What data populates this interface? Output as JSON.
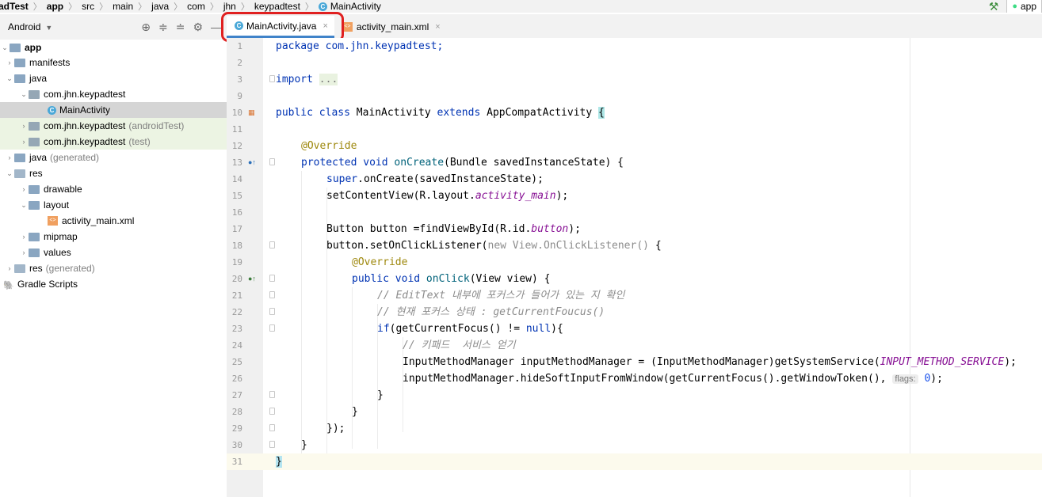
{
  "breadcrumb": {
    "items": [
      "adTest",
      "app",
      "src",
      "main",
      "java",
      "com",
      "jhn",
      "keypadtest",
      "MainActivity"
    ],
    "run_config": "app"
  },
  "project_panel": {
    "view_mode": "Android",
    "tree": [
      {
        "label": "app",
        "suffix": "",
        "indent": 0,
        "type": "module",
        "expanded": true
      },
      {
        "label": "manifests",
        "suffix": "",
        "indent": 1,
        "type": "folder",
        "expanded": false
      },
      {
        "label": "java",
        "suffix": "",
        "indent": 1,
        "type": "folder",
        "expanded": true
      },
      {
        "label": "com.jhn.keypadtest",
        "suffix": "",
        "indent": 2,
        "type": "package",
        "expanded": true
      },
      {
        "label": "MainActivity",
        "suffix": "",
        "indent": 3,
        "type": "class",
        "selected": true
      },
      {
        "label": "com.jhn.keypadtest",
        "suffix": "(androidTest)",
        "indent": 2,
        "type": "package",
        "expanded": false,
        "test": true
      },
      {
        "label": "com.jhn.keypadtest",
        "suffix": "(test)",
        "indent": 2,
        "type": "package",
        "expanded": false,
        "test": true
      },
      {
        "label": "java",
        "suffix": "(generated)",
        "indent": 1,
        "type": "folder",
        "expanded": false
      },
      {
        "label": "res",
        "suffix": "",
        "indent": 1,
        "type": "folder",
        "expanded": true
      },
      {
        "label": "drawable",
        "suffix": "",
        "indent": 2,
        "type": "folder",
        "expanded": false
      },
      {
        "label": "layout",
        "suffix": "",
        "indent": 2,
        "type": "folder",
        "expanded": true
      },
      {
        "label": "activity_main.xml",
        "suffix": "",
        "indent": 3,
        "type": "xml"
      },
      {
        "label": "mipmap",
        "suffix": "",
        "indent": 2,
        "type": "folder",
        "expanded": false
      },
      {
        "label": "values",
        "suffix": "",
        "indent": 2,
        "type": "folder",
        "expanded": false
      },
      {
        "label": "res",
        "suffix": "(generated)",
        "indent": 1,
        "type": "folder",
        "expanded": false
      },
      {
        "label": "Gradle Scripts",
        "suffix": "",
        "indent": 0,
        "type": "gradle",
        "expanded": false
      }
    ]
  },
  "tabs": [
    {
      "label": "MainActivity.java",
      "active": true
    },
    {
      "label": "activity_main.xml",
      "active": false
    }
  ],
  "code": {
    "line_numbers": [
      "1",
      "2",
      "3",
      "9",
      "10",
      "11",
      "12",
      "13",
      "14",
      "15",
      "16",
      "17",
      "18",
      "19",
      "20",
      "21",
      "22",
      "23",
      "24",
      "25",
      "26",
      "27",
      "28",
      "29",
      "30",
      "31"
    ],
    "lines": {
      "l1": "package com.jhn.keypadtest;",
      "l3_kw": "import",
      "l3_fold": "...",
      "l10_a": "public class",
      "l10_b": " MainActivity ",
      "l10_c": "extends",
      "l10_d": " AppCompatActivity ",
      "l10_e": "{",
      "l12": "@Override",
      "l13_a": "protected void",
      "l13_b": "onCreate",
      "l13_c": "(Bundle savedInstanceState) {",
      "l14_a": "super",
      "l14_b": ".onCreate(savedInstanceState);",
      "l15_a": "setContentView(R.layout.",
      "l15_b": "activity_main",
      "l15_c": ");",
      "l17_a": "Button button =findViewById(R.id.",
      "l17_b": "button",
      "l17_c": ");",
      "l18_a": "button.setOnClickListener(",
      "l18_b": "new View.OnClickListener()",
      "l18_c": " {",
      "l19": "@Override",
      "l20_a": "public void",
      "l20_b": "onClick",
      "l20_c": "(View view) {",
      "l21": "// EditText 내부에 포커스가 들어가 있는 지 확인",
      "l22": "// 현재 포커스 상태 : getCurrentFoucus()",
      "l23_a": "if",
      "l23_b": "(getCurrentFocus() != ",
      "l23_c": "null",
      "l23_d": "){",
      "l24": "// 키패드  서비스 얻기",
      "l25_a": "InputMethodManager inputMethodManager = (InputMethodManager)getSystemService(",
      "l25_b": "INPUT_METHOD_SERVICE",
      "l25_c": ");",
      "l26_a": "inputMethodManager.hideSoftInputFromWindow(getCurrentFocus().getWindowToken(),",
      "l26_hint": "flags:",
      "l26_num": "0",
      "l26_c": ");",
      "l27": "}",
      "l28": "}",
      "l29": "});",
      "l30": "}",
      "l31": "}"
    }
  }
}
